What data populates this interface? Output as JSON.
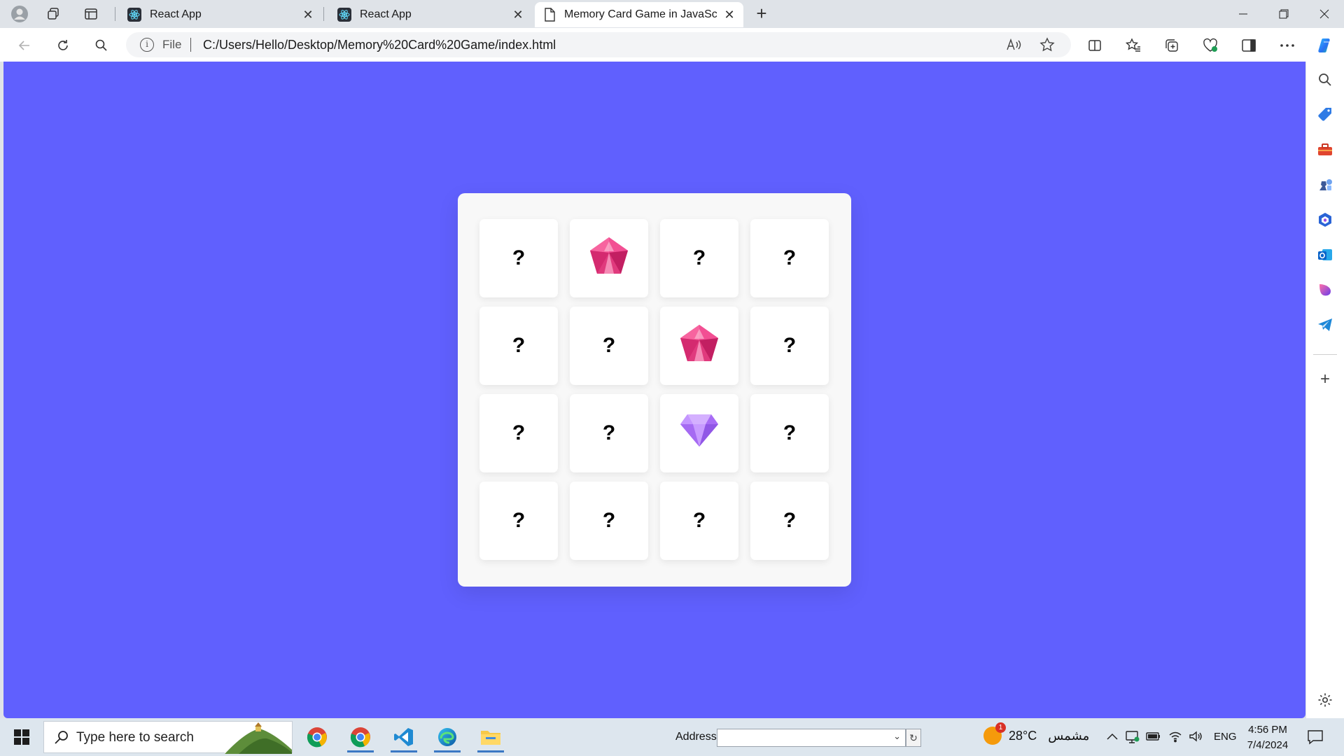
{
  "browser": {
    "tabs": [
      {
        "title": "React App",
        "icon": "react-icon",
        "active": false
      },
      {
        "title": "React App",
        "icon": "react-icon",
        "active": false
      },
      {
        "title": "Memory Card Game in JavaScript",
        "icon": "document-icon",
        "active": true
      }
    ],
    "address": {
      "scheme_label": "File",
      "url": "C:/Users/Hello/Desktop/Memory%20Card%20Game/index.html"
    },
    "sidebar_icons": [
      "search-icon",
      "shopping-tag-icon",
      "toolbox-icon",
      "games-icon",
      "microsoft-365-icon",
      "outlook-icon",
      "designer-icon",
      "telegram-icon"
    ]
  },
  "game": {
    "background_color": "#6060fe",
    "cards": [
      {
        "face": "?",
        "flipped": false
      },
      {
        "face": "pink-gem",
        "flipped": true
      },
      {
        "face": "?",
        "flipped": false
      },
      {
        "face": "?",
        "flipped": false
      },
      {
        "face": "?",
        "flipped": false
      },
      {
        "face": "?",
        "flipped": false
      },
      {
        "face": "pink-gem",
        "flipped": true
      },
      {
        "face": "?",
        "flipped": false
      },
      {
        "face": "?",
        "flipped": false
      },
      {
        "face": "?",
        "flipped": false
      },
      {
        "face": "purple-diamond",
        "flipped": true
      },
      {
        "face": "?",
        "flipped": false
      },
      {
        "face": "?",
        "flipped": false
      },
      {
        "face": "?",
        "flipped": false
      },
      {
        "face": "?",
        "flipped": false
      },
      {
        "face": "?",
        "flipped": false
      }
    ]
  },
  "taskbar": {
    "search_placeholder": "Type here to search",
    "apps": [
      "chrome-icon",
      "chrome-icon",
      "vscode-icon",
      "edge-icon",
      "file-explorer-icon"
    ],
    "address_toolbar_label": "Address",
    "weather": {
      "temperature": "28°C",
      "condition": "مشمس",
      "badge_count": "1"
    },
    "language": "ENG",
    "time": "4:56 PM",
    "date": "7/4/2024"
  }
}
